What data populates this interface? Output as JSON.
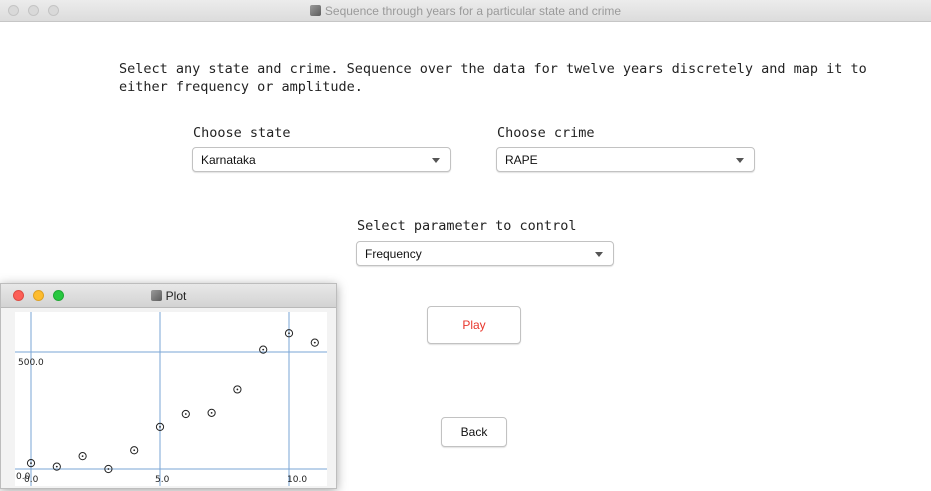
{
  "window": {
    "title": "Sequence through years for a particular state and crime"
  },
  "main": {
    "description": "Select any state and crime. Sequence over the data for twelve years discretely and map it to either frequency or amplitude.",
    "state": {
      "label": "Choose state",
      "value": "Karnataka"
    },
    "crime": {
      "label": "Choose crime",
      "value": "RAPE"
    },
    "parameter": {
      "label": "Select parameter to control",
      "value": "Frequency"
    },
    "play_label": "Play",
    "back_label": "Back"
  },
  "plot_window": {
    "title": "Plot"
  },
  "colors": {
    "play_text": "#e8352b",
    "axis_line": "#7aa6d6",
    "close": "#fc5f57",
    "minimize": "#fdbc2e",
    "zoom": "#28c840"
  },
  "chart_data": {
    "type": "scatter",
    "x_ticks": [
      "0.0",
      "5.0",
      "10.0"
    ],
    "y_ticks": [
      "0.0",
      "500.0"
    ],
    "xlim": [
      0,
      11
    ],
    "ylim": [
      0,
      560
    ],
    "grid_x": [
      0,
      5,
      10
    ],
    "grid_y": [
      0,
      500
    ],
    "points": [
      {
        "x": 0,
        "y": 25
      },
      {
        "x": 1,
        "y": 10
      },
      {
        "x": 2,
        "y": 55
      },
      {
        "x": 3,
        "y": 0
      },
      {
        "x": 4,
        "y": 80
      },
      {
        "x": 5,
        "y": 180
      },
      {
        "x": 6,
        "y": 235
      },
      {
        "x": 7,
        "y": 240
      },
      {
        "x": 8,
        "y": 340
      },
      {
        "x": 9,
        "y": 510
      },
      {
        "x": 10,
        "y": 580
      },
      {
        "x": 11,
        "y": 540
      }
    ]
  }
}
